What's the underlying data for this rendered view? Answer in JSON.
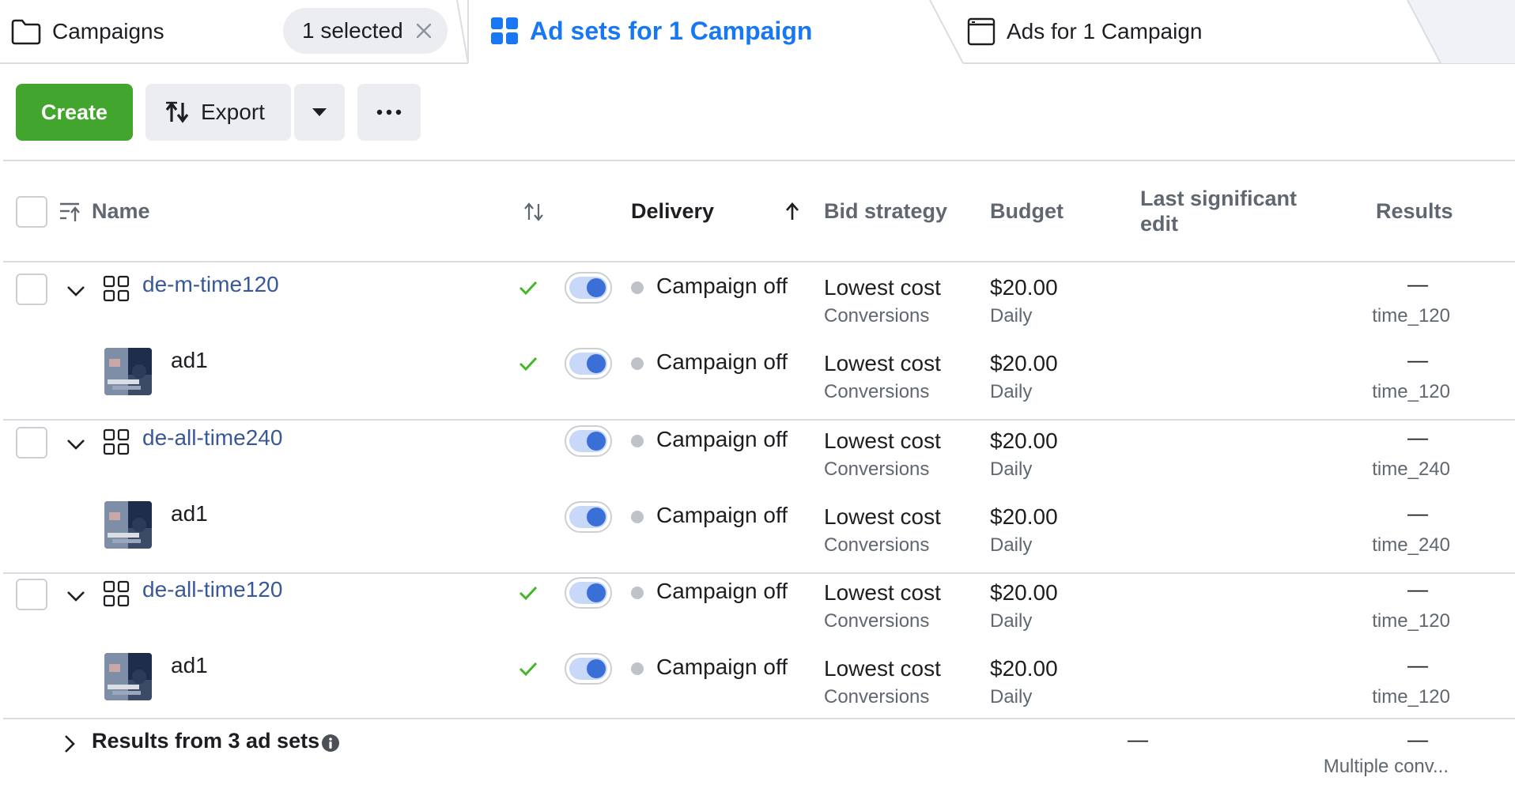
{
  "tabs": {
    "campaigns_label": "Campaigns",
    "selected_pill": "1 selected",
    "adsets_label": "Ad sets for 1 Campaign",
    "ads_label": "Ads for 1 Campaign"
  },
  "toolbar": {
    "create_label": "Create",
    "export_label": "Export",
    "more_icon": "ellipsis-icon",
    "caret_icon": "caret-down-icon"
  },
  "table": {
    "headers": {
      "name": "Name",
      "delivery": "Delivery",
      "bid_strategy": "Bid strategy",
      "budget": "Budget",
      "last_edit_line1": "Last significant",
      "last_edit_line2": "edit",
      "results": "Results"
    },
    "rows": [
      {
        "kind": "adset",
        "name": "de-m-time120",
        "checked": true,
        "toggle_on": true,
        "delivery": "Campaign off",
        "bid": "Lowest cost",
        "bid_sub": "Conversions",
        "budget": "$20.00",
        "budget_sub": "Daily",
        "result": "—",
        "result_sub": "time_120"
      },
      {
        "kind": "ad",
        "name": "ad1",
        "checked": true,
        "toggle_on": true,
        "delivery": "Campaign off",
        "bid": "Lowest cost",
        "bid_sub": "Conversions",
        "budget": "$20.00",
        "budget_sub": "Daily",
        "result": "—",
        "result_sub": "time_120"
      },
      {
        "kind": "adset",
        "name": "de-all-time240",
        "checked": false,
        "toggle_on": true,
        "delivery": "Campaign off",
        "bid": "Lowest cost",
        "bid_sub": "Conversions",
        "budget": "$20.00",
        "budget_sub": "Daily",
        "result": "—",
        "result_sub": "time_240"
      },
      {
        "kind": "ad",
        "name": "ad1",
        "checked": false,
        "toggle_on": true,
        "delivery": "Campaign off",
        "bid": "Lowest cost",
        "bid_sub": "Conversions",
        "budget": "$20.00",
        "budget_sub": "Daily",
        "result": "—",
        "result_sub": "time_240"
      },
      {
        "kind": "adset",
        "name": "de-all-time120",
        "checked": true,
        "toggle_on": true,
        "delivery": "Campaign off",
        "bid": "Lowest cost",
        "bid_sub": "Conversions",
        "budget": "$20.00",
        "budget_sub": "Daily",
        "result": "—",
        "result_sub": "time_120"
      },
      {
        "kind": "ad",
        "name": "ad1",
        "checked": true,
        "toggle_on": true,
        "delivery": "Campaign off",
        "bid": "Lowest cost",
        "bid_sub": "Conversions",
        "budget": "$20.00",
        "budget_sub": "Daily",
        "result": "—",
        "result_sub": "time_120"
      }
    ],
    "footer": {
      "label": "Results from 3 ad sets",
      "last_edit": "—",
      "result": "—",
      "result_sub": "Multiple conv..."
    }
  },
  "colors": {
    "accent": "#1877f2",
    "create_green": "#42a52e",
    "link": "#385898",
    "check_green": "#42b72a",
    "toggle_knob": "#3a6fd8"
  }
}
